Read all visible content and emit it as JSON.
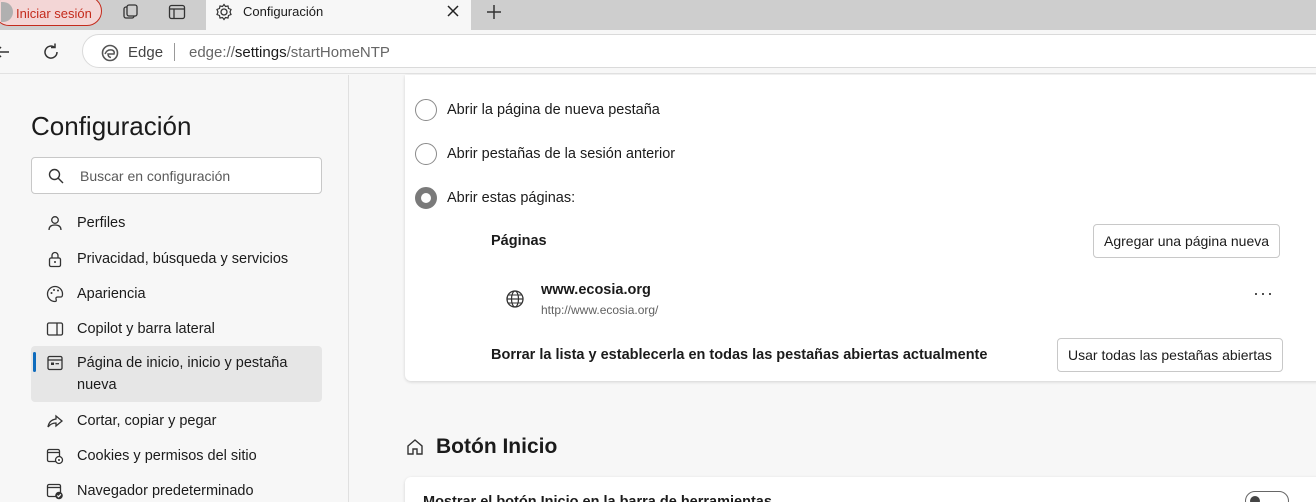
{
  "tabstrip": {
    "signin_label": "Iniciar sesión",
    "active_tab_title": "Configuración"
  },
  "toolbar": {
    "site_label": "Edge",
    "url_prefix": "edge://",
    "url_bold": "settings",
    "url_suffix": "/startHomeNTP"
  },
  "sidebar": {
    "title": "Configuración",
    "search_placeholder": "Buscar en configuración",
    "items": [
      {
        "label": "Perfiles",
        "icon": "profile-icon"
      },
      {
        "label": "Privacidad, búsqueda y servicios",
        "icon": "lock-icon"
      },
      {
        "label": "Apariencia",
        "icon": "palette-icon"
      },
      {
        "label": "Copilot y barra lateral",
        "icon": "sidebar-icon"
      },
      {
        "label": "Página de inicio, inicio y pestaña nueva",
        "icon": "home-page-icon",
        "active": true
      },
      {
        "label": "Cortar, copiar y pegar",
        "icon": "share-icon"
      },
      {
        "label": "Cookies y permisos del sitio",
        "icon": "cookies-icon"
      },
      {
        "label": "Navegador predeterminado",
        "icon": "default-browser-icon"
      }
    ]
  },
  "startup": {
    "options": [
      {
        "label": "Abrir la página de nueva pestaña",
        "selected": false
      },
      {
        "label": "Abrir pestañas de la sesión anterior",
        "selected": false
      },
      {
        "label": "Abrir estas páginas:",
        "selected": true
      }
    ],
    "pages_heading": "Páginas",
    "add_page_button": "Agregar una página nueva",
    "pages": [
      {
        "name": "www.ecosia.org",
        "url": "http://www.ecosia.org/"
      }
    ],
    "more_label": "···",
    "clear_label": "Borrar la lista y establecerla en todas las pestañas abiertas actualmente",
    "use_all_tabs_button": "Usar todas las pestañas abiertas"
  },
  "home_button": {
    "title": "Botón Inicio",
    "setting_label": "Mostrar el botón Inicio en la barra de herramientas"
  }
}
